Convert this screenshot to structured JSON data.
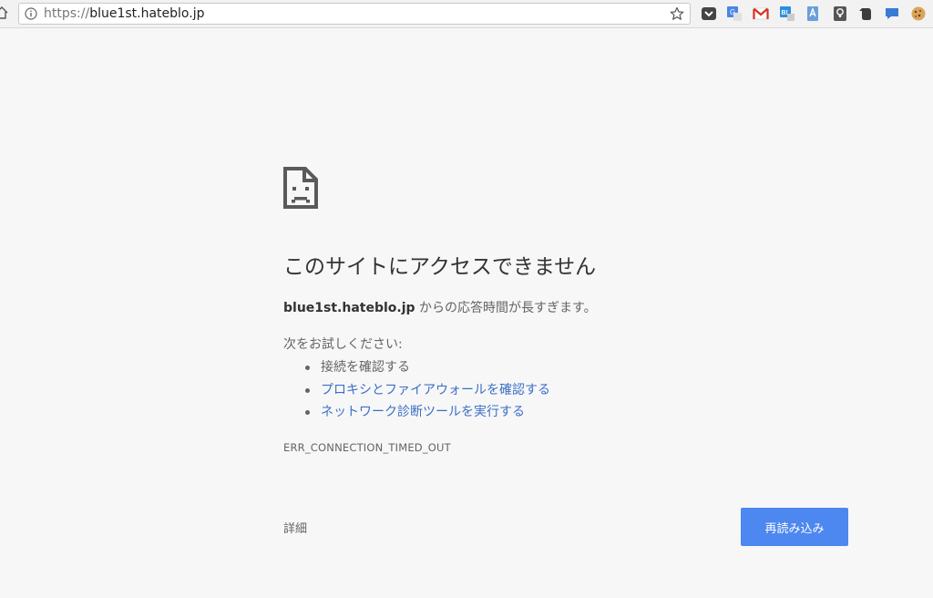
{
  "browser": {
    "url_scheme": "https://",
    "url_host": "blue1st.hateblo.jp"
  },
  "error_page": {
    "title": "このサイトにアクセスできません",
    "host": "blue1st.hateblo.jp",
    "summary_suffix": " からの応答時間が長すぎます。",
    "try_label": "次をお試しください:",
    "suggestions": [
      {
        "text": "接続を確認する",
        "is_link": false
      },
      {
        "text": "プロキシとファイアウォールを確認する",
        "is_link": true
      },
      {
        "text": "ネットワーク診断ツールを実行する",
        "is_link": true
      }
    ],
    "error_code": "ERR_CONNECTION_TIMED_OUT",
    "details_label": "詳細",
    "reload_label": "再読み込み"
  },
  "extensions": [
    "pocket-icon",
    "translate-icon",
    "gmail-icon",
    "hatena-bookmark-icon",
    "printfriendly-icon",
    "keep-icon",
    "evernote-icon",
    "chat-icon",
    "cookie-icon"
  ],
  "colors": {
    "link": "#3b6fc6",
    "button": "#4d87f0",
    "background": "#f7f7f7"
  }
}
